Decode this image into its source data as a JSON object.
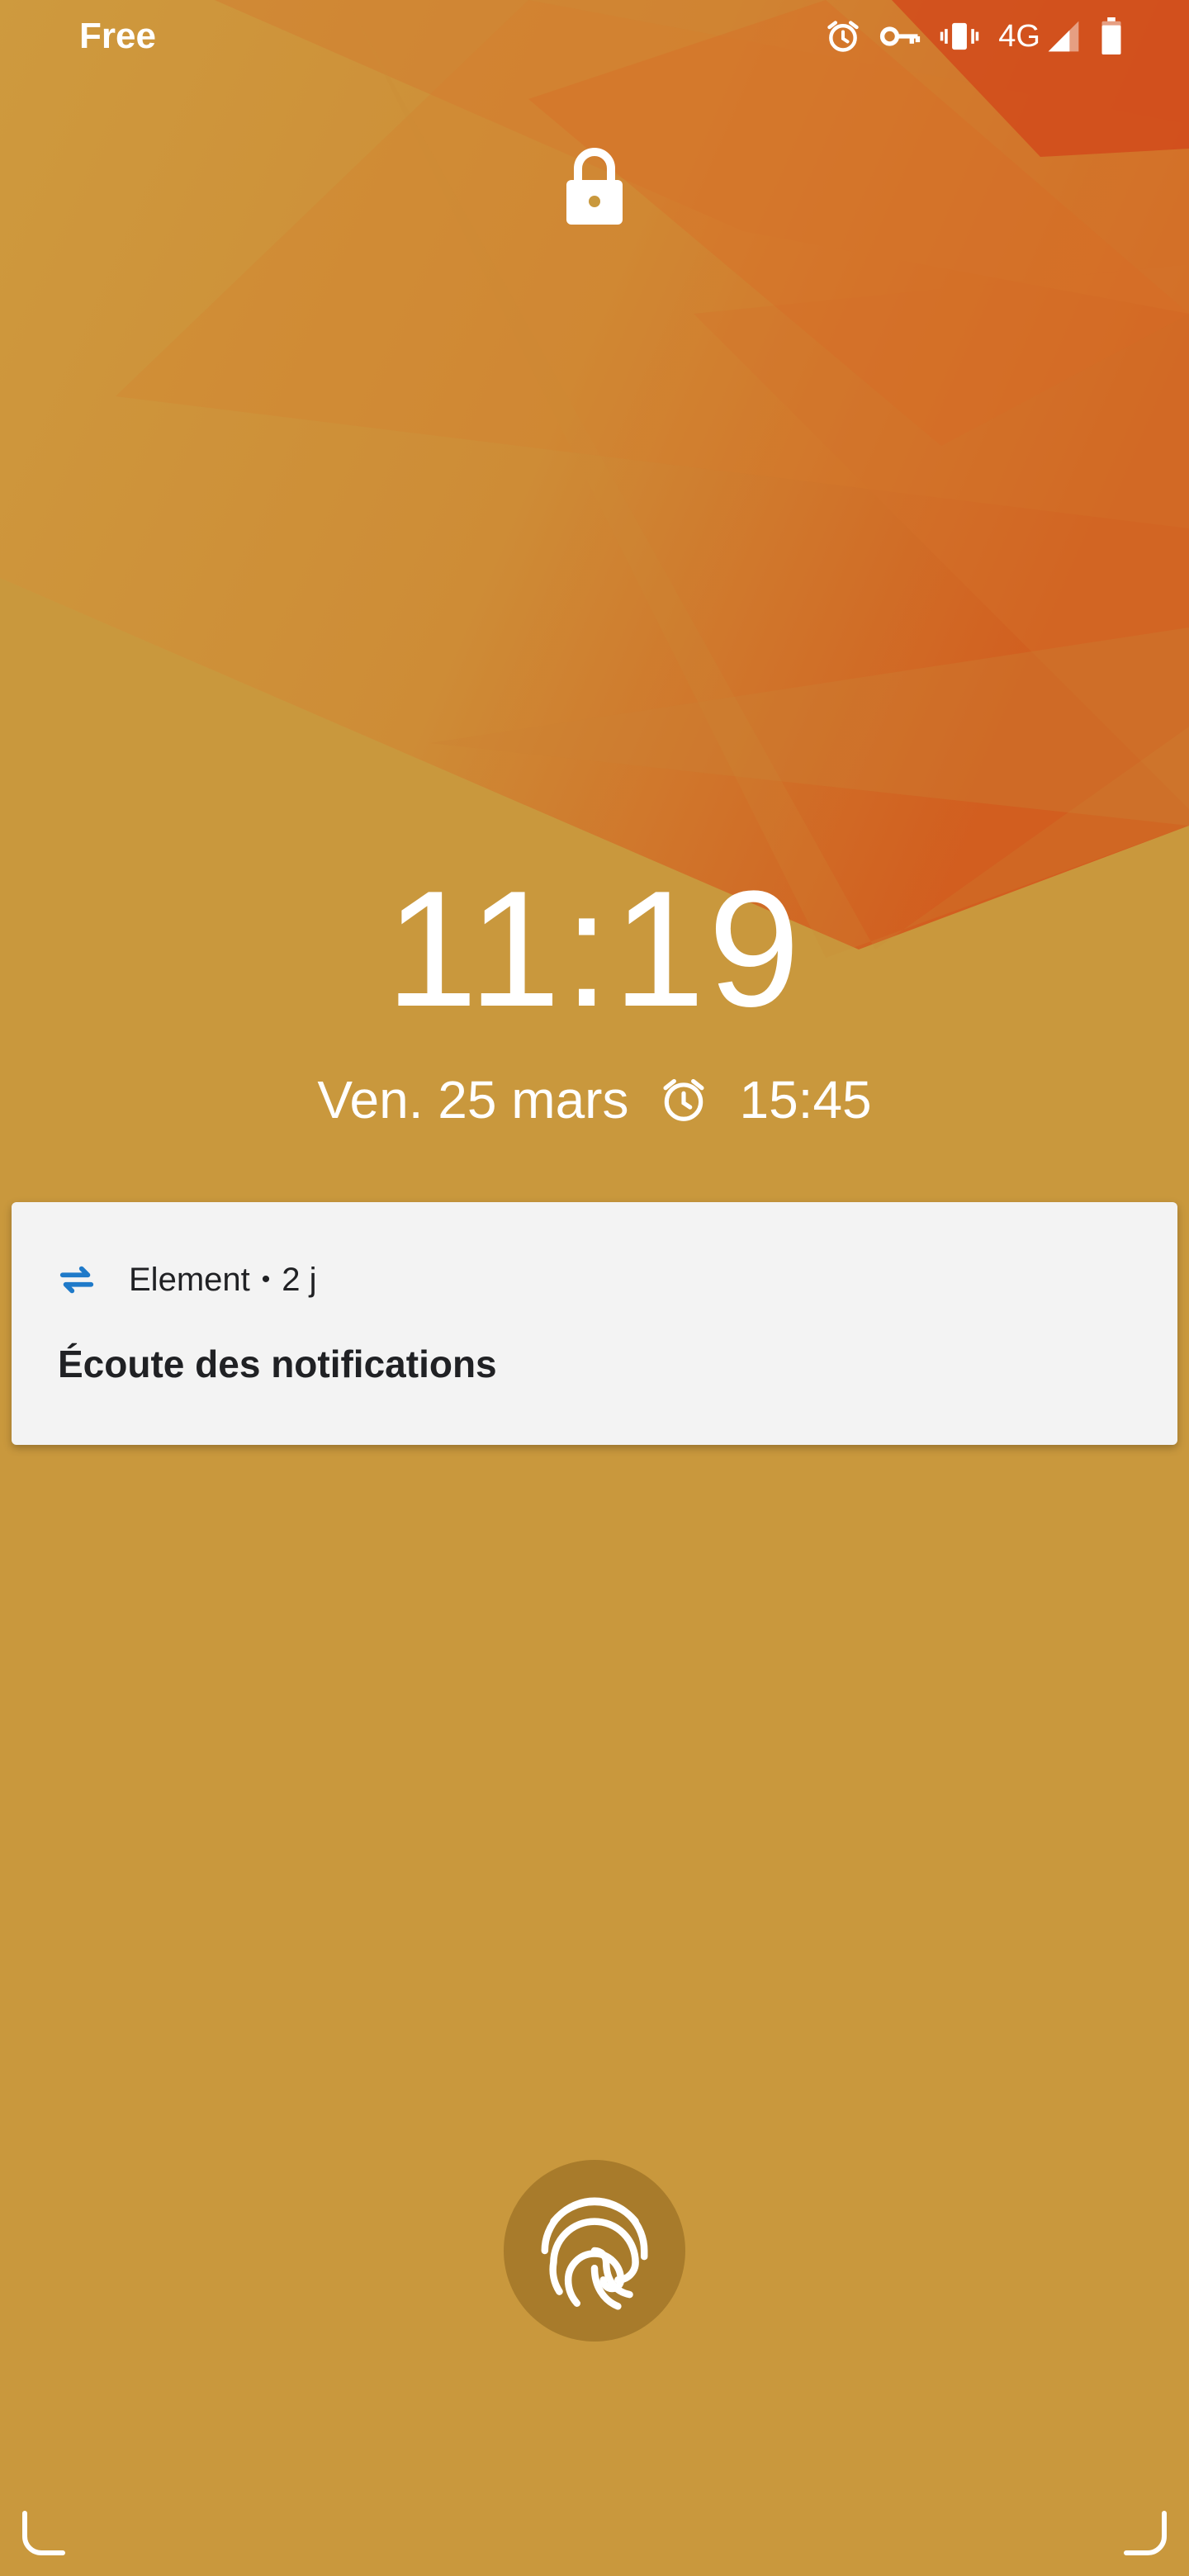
{
  "status_bar": {
    "carrier": "Free",
    "network": "4G",
    "icons": [
      "alarm-icon",
      "vpn-key-icon",
      "vibrate-icon",
      "signal-icon",
      "battery-icon"
    ]
  },
  "lock_screen": {
    "lock_icon": "lock-icon",
    "time": "11:19",
    "date": "Ven. 25 mars",
    "alarm_time": "15:45"
  },
  "notification": {
    "app_name": "Element",
    "separator": "•",
    "age": "2 j",
    "title": "Écoute des notifications",
    "app_icon_color": "#1f7ac9"
  },
  "colors": {
    "background": "#c9983d",
    "wallpaper_accent": "#d2521a",
    "card": "#f3f3f3",
    "text_dark": "#202124"
  },
  "bottom": {
    "fingerprint_icon": "fingerprint-icon"
  }
}
